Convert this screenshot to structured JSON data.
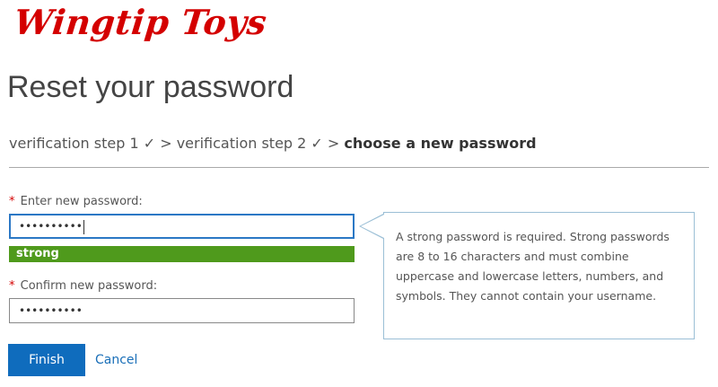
{
  "brand": {
    "logo_text": "Wingtip Toys"
  },
  "page": {
    "title": "Reset your password"
  },
  "breadcrumb": {
    "step1": "verification step 1 ✓",
    "sep1": " > ",
    "step2": "verification step 2 ✓",
    "sep2": " > ",
    "current": "choose a new password"
  },
  "form": {
    "required_marker": "*",
    "new_password_label": "Enter new password:",
    "new_password_value": "••••••••••",
    "strength_label": "strong",
    "confirm_password_label": "Confirm new password:",
    "confirm_password_value": "••••••••••",
    "finish_label": "Finish",
    "cancel_label": "Cancel"
  },
  "tooltip": {
    "text": "A strong password is required. Strong passwords are 8 to 16 characters and must combine uppercase and lowercase letters, numbers, and symbols. They cannot contain your username."
  },
  "colors": {
    "brand_red": "#d40000",
    "accent_blue": "#0f6cbd",
    "strength_green": "#4f9a1c"
  }
}
